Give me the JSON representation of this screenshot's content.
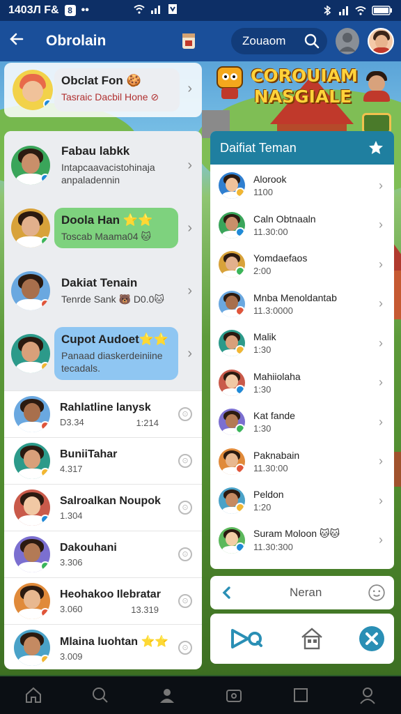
{
  "statusbar": {
    "time": "1403Л F&",
    "left_icon_label": "8",
    "dots": "••"
  },
  "header": {
    "title": "Obrolain",
    "search_label": "Zouaom"
  },
  "game": {
    "logo_line1": "COROUIAM",
    "logo_line2": "NASGIALE"
  },
  "pinned_chat": {
    "name": "Obclat Fon 🍪",
    "sub": "Tasraic Dacbil Hone ⊘"
  },
  "chat_cards": [
    {
      "name": "Fabau labkk",
      "sub": "Intapcaavacistohinaja anpaladennin",
      "bg": "#ffffff"
    },
    {
      "name": "Doola Han ⭐⭐",
      "sub": "Toscab Maama04 🐱",
      "bg": "#7ed27e"
    },
    {
      "name": "Dakiat Tenain",
      "sub": "Tenrde Sank 🐻 D0.0🐱",
      "bg": "#ffffff"
    },
    {
      "name": "Cupot Audoet⭐⭐",
      "sub": "Panaad diaskerdeiniine tecadals.",
      "bg": "#8fc6f2"
    }
  ],
  "chat_list": [
    {
      "name": "Rahlatline lanysk",
      "sub": "D3.34",
      "time": "1:214",
      "action": "⊙"
    },
    {
      "name": "BuniiTahar",
      "sub": "4.317",
      "time": "",
      "action": "⊙"
    },
    {
      "name": "Salroalkan Noupok",
      "sub": "1.304",
      "time": "",
      "action": "⊙"
    },
    {
      "name": "Dakouhani",
      "sub": "3.306",
      "time": "",
      "action": "⊙"
    },
    {
      "name": "Heohakoo Ilebratar",
      "sub": "3.060",
      "time": "13.319",
      "action": "⊙"
    },
    {
      "name": "Mlaina luohtan ⭐⭐",
      "sub": "3.009",
      "time": "",
      "action": "⊙"
    }
  ],
  "friends": {
    "title": "Daifiat Teman",
    "items": [
      {
        "name": "Alorook",
        "sub": "1100"
      },
      {
        "name": "Caln Obtnaaln",
        "sub": "11.30:00"
      },
      {
        "name": "Yomdaefaos",
        "sub": "2:00"
      },
      {
        "name": "Mnba Menoldantab",
        "sub": "11.3:0000"
      },
      {
        "name": "Malik",
        "sub": "1:30"
      },
      {
        "name": "Mahiiolaha",
        "sub": "1:30"
      },
      {
        "name": "Kat fande",
        "sub": "1:30"
      },
      {
        "name": "Paknabain",
        "sub": "11.30:00"
      },
      {
        "name": "Peldon",
        "sub": "1:20"
      },
      {
        "name": "Suram Moloon 🐱🐱",
        "sub": "11.30:300"
      }
    ]
  },
  "input": {
    "placeholder": "Neran"
  },
  "colors": {
    "header": "#1a4f9a",
    "statusbar": "#0d2f66",
    "friends_header": "#1f7fa0",
    "accent": "#2a8fb5"
  }
}
